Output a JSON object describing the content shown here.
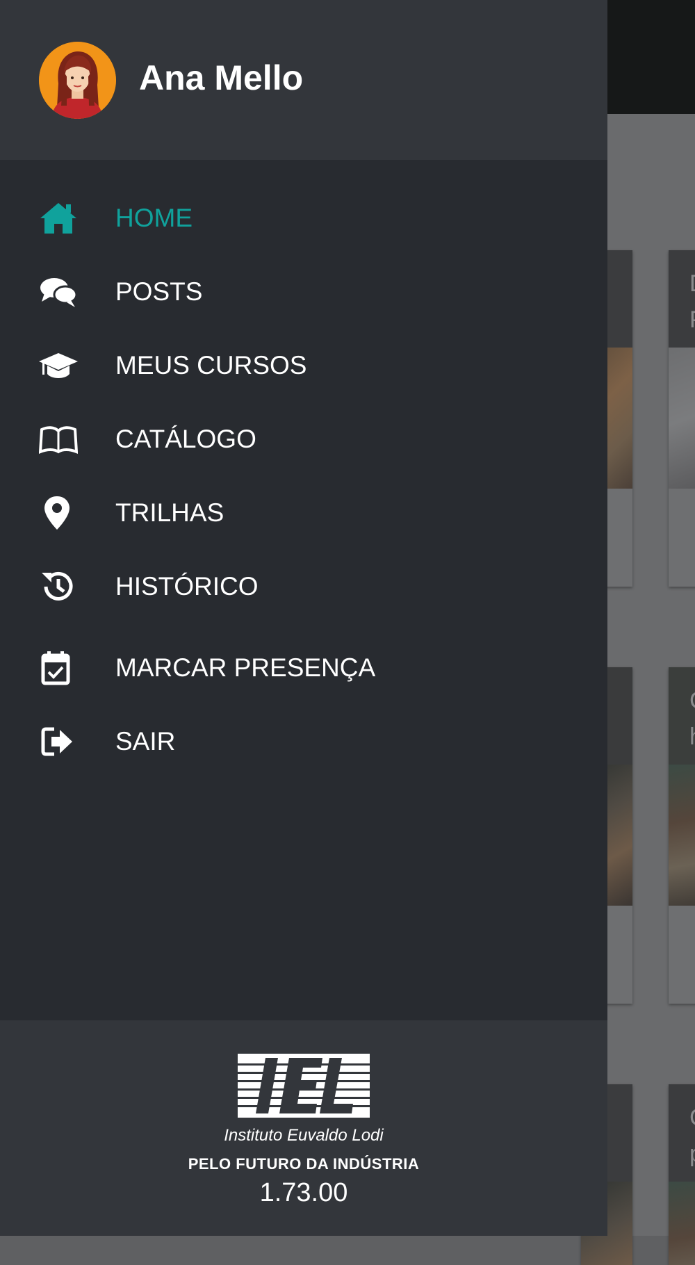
{
  "drawer": {
    "user": {
      "name": "Ana Mello"
    },
    "menu": [
      {
        "label": "HOME",
        "icon": "home-icon",
        "active": true
      },
      {
        "label": "POSTS",
        "icon": "comments-icon",
        "active": false
      },
      {
        "label": "MEUS CURSOS",
        "icon": "graduation-cap-icon",
        "active": false
      },
      {
        "label": "CATÁLOGO",
        "icon": "open-book-icon",
        "active": false
      },
      {
        "label": "TRILHAS",
        "icon": "map-marker-icon",
        "active": false
      },
      {
        "label": "HISTÓRICO",
        "icon": "history-icon",
        "active": false
      },
      {
        "label": "MARCAR PRESENÇA",
        "icon": "calendar-check-icon",
        "active": false
      },
      {
        "label": "SAIR",
        "icon": "sign-out-icon",
        "active": false
      }
    ],
    "footer": {
      "logo_text": "IEL",
      "tagline": "Instituto Euvaldo Lodi",
      "slogan": "PELO FUTURO DA INDÚSTRIA",
      "version": "1.73.00"
    }
  },
  "background_cards_visible_letters": [
    "D",
    "P",
    "C",
    "h",
    "C",
    "p"
  ],
  "colors": {
    "drawer_bg": "#282b30",
    "drawer_header_bg": "#33363b",
    "accent": "#10a29c",
    "avatar_bg": "#f29418",
    "text": "#ffffff"
  }
}
